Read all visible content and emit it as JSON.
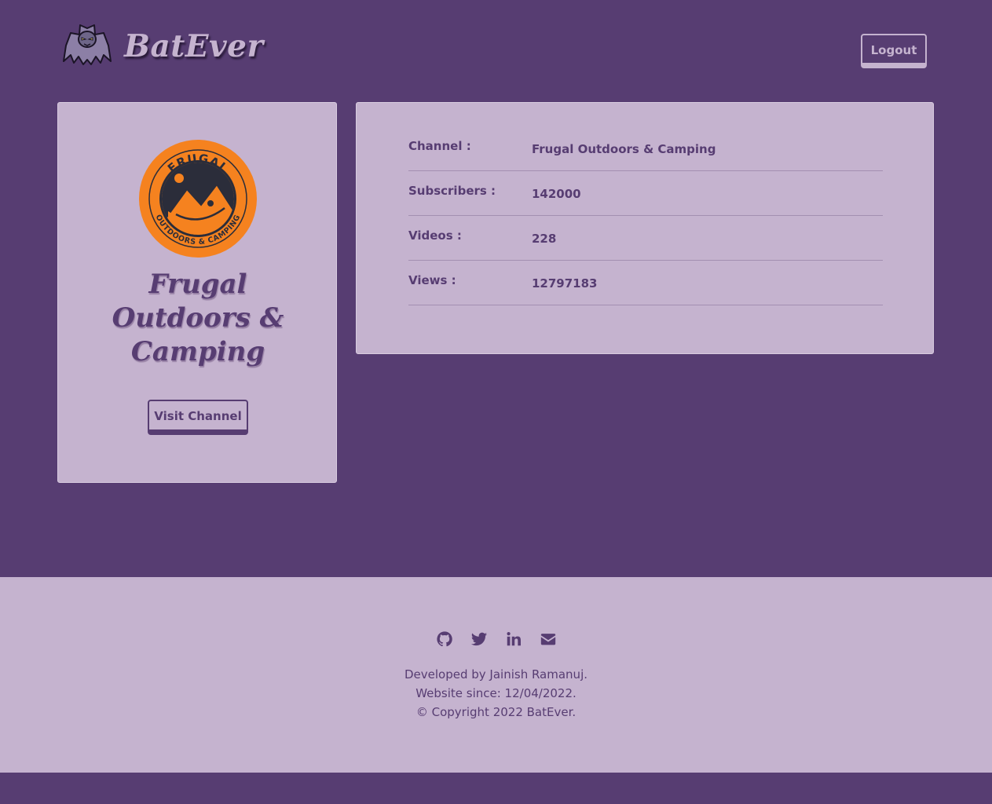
{
  "header": {
    "brand": "BatEver",
    "logout_label": "Logout"
  },
  "channel": {
    "title": "Frugal Outdoors & Camping",
    "visit_label": "Visit Channel",
    "avatar_text_top": "FRUGAL",
    "avatar_text_bottom": "OUTDOORS & CAMPING"
  },
  "stats": [
    {
      "label": "Channel :",
      "value": "Frugal Outdoors & Camping"
    },
    {
      "label": "Subscribers :",
      "value": "142000"
    },
    {
      "label": "Videos :",
      "value": "228"
    },
    {
      "label": "Views :",
      "value": "12797183"
    }
  ],
  "footer": {
    "line1": "Developed by Jainish Ramanuj.",
    "line2": "Website since: 12/04/2022.",
    "line3": "© Copyright 2022 BatEver.",
    "icons": [
      "github-icon",
      "twitter-icon",
      "linkedin-icon",
      "email-icon"
    ]
  },
  "colors": {
    "background": "#573d72",
    "card": "#c5b3cf",
    "accent_orange": "#f5821f",
    "dark": "#2b2d3a"
  }
}
